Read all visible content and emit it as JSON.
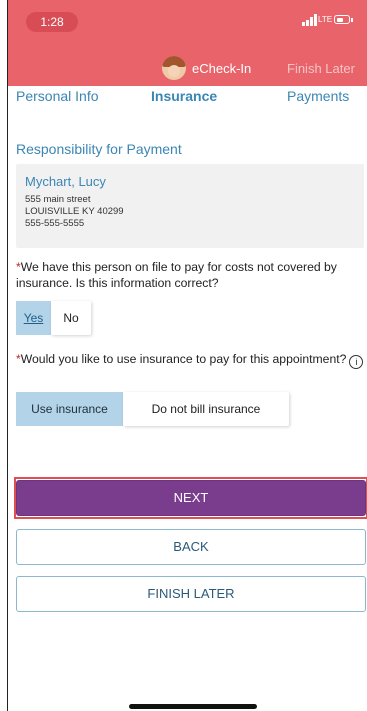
{
  "status_bar": {
    "time": "1:28",
    "network": "LTE"
  },
  "nav": {
    "title": "eCheck-In",
    "finish_later": "Finish Later"
  },
  "steps": [
    {
      "label": "Personal Info",
      "active": false
    },
    {
      "label": "Insurance",
      "active": true
    },
    {
      "label": "Payments",
      "active": false
    }
  ],
  "section": {
    "title": "Responsibility for Payment"
  },
  "responsible": {
    "name": "Mychart, Lucy",
    "address1": "555 main street",
    "address2": "LOUISVILLE KY 40299",
    "phone": "555-555-5555"
  },
  "question1": {
    "required_mark": "*",
    "text": "We have this person on file to pay for costs not covered by insurance. Is this information correct?",
    "options": [
      "Yes",
      "No"
    ],
    "selected": "Yes"
  },
  "question2": {
    "required_mark": "*",
    "text": "Would you like to use insurance to pay for this appointment?",
    "info_glyph": "i",
    "options": [
      "Use insurance",
      "Do not bill insurance"
    ],
    "selected": "Use insurance"
  },
  "buttons": {
    "next": "NEXT",
    "back": "BACK",
    "finish_later": "FINISH LATER"
  },
  "colors": {
    "header": "#e8646a",
    "link_blue": "#3b86b4",
    "primary_purple": "#7a3d8e",
    "selected_segment": "#b3d3e8",
    "highlight_red": "#e05050"
  }
}
